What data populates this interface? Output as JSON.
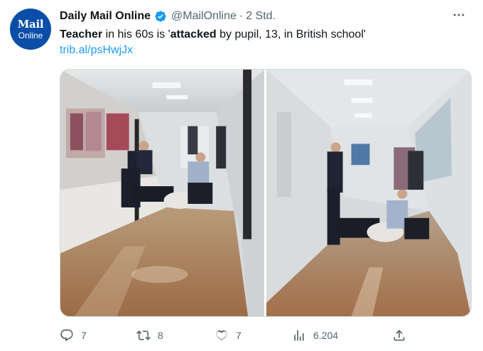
{
  "account": {
    "avatar_line1": "Mail",
    "avatar_line2": "Online",
    "name": "Daily Mail Online",
    "handle": "@MailOnline",
    "separator": "·",
    "time": "2 Std."
  },
  "tweet": {
    "text_part1": "Teacher",
    "text_part2": " in his 60s is '",
    "text_part3": "attacked",
    "text_part4": " by pupil, 13, in British school'",
    "link": "trib.al/psHwjJx"
  },
  "actions": {
    "replies": "7",
    "retweets": "8",
    "likes": "7",
    "views": "6.204"
  },
  "colors": {
    "brand_blue": "#0a4ea8",
    "link_blue": "#1d9bf0",
    "muted": "#536471"
  }
}
